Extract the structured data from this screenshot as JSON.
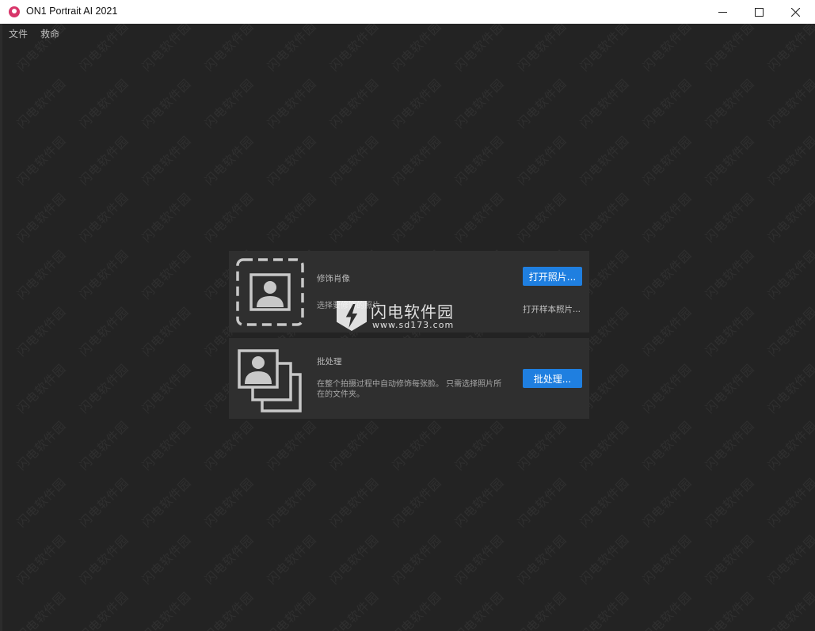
{
  "window": {
    "title": "ON1 Portrait AI 2021",
    "minimize_symbol": "—",
    "maximize_symbol": "☐",
    "close_symbol": "✕"
  },
  "menu": {
    "items": [
      {
        "label": "文件"
      },
      {
        "label": "救命"
      }
    ]
  },
  "cards": {
    "portrait": {
      "title": "修饰肖像",
      "description": "选择要修饰的照片",
      "button_label": "打开照片...",
      "sample_link": "打开样本照片...",
      "icon": "portrait-frame-icon"
    },
    "batch": {
      "title": "批处理",
      "description": "在整个拍摄过程中自动修饰每张脸。 只需选择照片所在的文件夹。",
      "button_label": "批处理...",
      "icon": "photo-stack-icon"
    }
  },
  "watermark": {
    "text": "闪电软件园",
    "logo_text": "闪电软件园",
    "logo_url": "www.sd173.com"
  },
  "colors": {
    "background": "#232323",
    "card": "#2f2f2f",
    "accent": "#1f7fe0",
    "app_icon": "#d8366a"
  }
}
